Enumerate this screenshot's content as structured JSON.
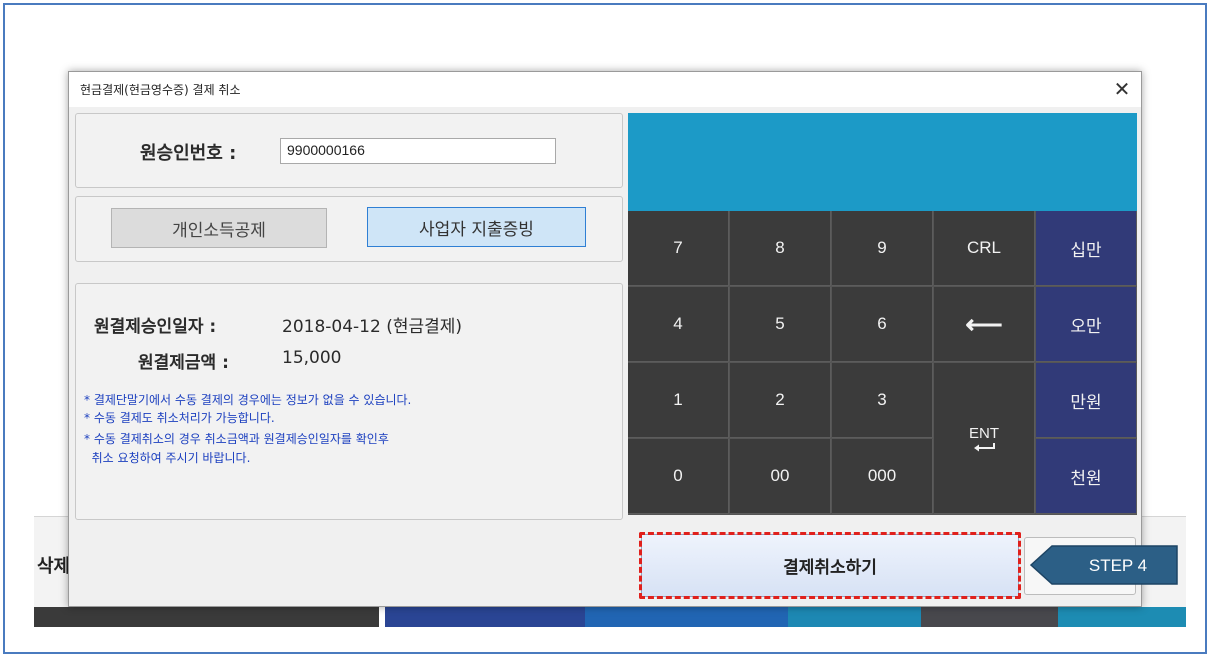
{
  "background": {
    "left_label": "삭제",
    "bar_colors": [
      "#3a3a3a",
      "#ffffff",
      "#2a4594",
      "#2165b3",
      "#1d88b3",
      "#48484d",
      "#1d8cb3"
    ]
  },
  "dialog": {
    "title": "현금결제(현금영수증) 결제 취소",
    "close": "✕"
  },
  "approval": {
    "label": "원승인번호 :",
    "value": "9900000166"
  },
  "type_buttons": {
    "personal": "개인소득공제",
    "business": "사업자 지출증빙"
  },
  "info": {
    "date_label": "원결제승인일자 :",
    "date_value": "2018-04-12 (현금결제)",
    "amount_label": "원결제금액 :",
    "amount_value": "15,000"
  },
  "notes": [
    "* 결제단말기에서 수동 결제의 경우에는 정보가 없을 수 있습니다.",
    "* 수동 결제도 취소처리가 가능합니다.",
    "* 수동 결제취소의 경우 취소금액과 원결제승인일자를 확인후",
    "  취소 요청하여 주시기 바랍니다."
  ],
  "keypad": {
    "k7": "7",
    "k8": "8",
    "k9": "9",
    "crl": "CRL",
    "ten_thousand_x10": "십만",
    "k4": "4",
    "k5": "5",
    "k6": "6",
    "backspace": "⟵",
    "fifty_thousand": "오만",
    "k1": "1",
    "k2": "2",
    "k3": "3",
    "ten_thousand": "만원",
    "k0": "0",
    "k00": "00",
    "k000": "000",
    "ent": "ENT",
    "thousand": "천원"
  },
  "cancel_button": "결제취소하기",
  "step_label": "STEP 4",
  "colors": {
    "display": "#1c9ac7",
    "key_dark": "#3b3b3b",
    "key_blue": "#313a78",
    "highlight": "#e0201c",
    "step_fill": "#2c5f86"
  }
}
